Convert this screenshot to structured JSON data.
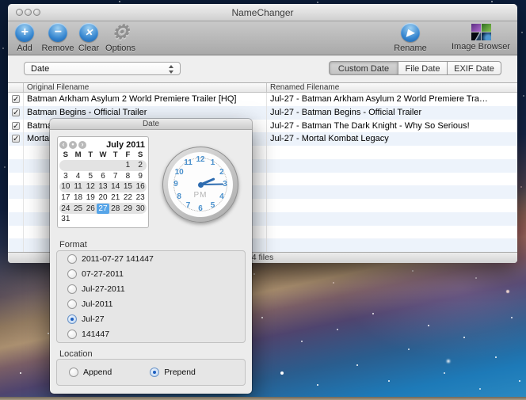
{
  "icons": {
    "add": "+",
    "remove": "−",
    "clear": "✕",
    "options_gear": "⚙",
    "rename_play": "▶",
    "check": "✓",
    "cal_prev": "‹",
    "cal_today": "•",
    "cal_next": "›"
  },
  "colors": {
    "accent_blue": "#2e7bc4",
    "selected_day_blue": "#57a5e8",
    "alt_row_blue": "#edf3fb"
  },
  "window": {
    "title": "NameChanger",
    "toolbar": {
      "add": "Add",
      "remove": "Remove",
      "clear": "Clear",
      "options": "Options",
      "rename": "Rename",
      "image_browser": "Image Browser"
    },
    "filter": {
      "action_value": "Date",
      "segments": [
        "Custom Date",
        "File Date",
        "EXIF Date"
      ],
      "selected_segment": "Custom Date"
    },
    "table": {
      "columns": [
        "Original Filename",
        "Renamed Filename"
      ],
      "rows": [
        {
          "checked": true,
          "original": "Batman Arkham Asylum 2 World Premiere Trailer [HQ]",
          "renamed": "Jul-27 - Batman Arkham Asylum 2 World Premiere Tra…"
        },
        {
          "checked": true,
          "original": "Batman Begins - Official Trailer",
          "renamed": "Jul-27 - Batman Begins - Official Trailer"
        },
        {
          "checked": true,
          "original": "Batman The Dark Knight - Why So Serious!",
          "renamed": "Jul-27 - Batman The Dark Knight - Why So Serious!"
        },
        {
          "checked": true,
          "original": "Mortal Kombat Legacy",
          "renamed": "Jul-27 - Mortal Kombat Legacy"
        }
      ]
    },
    "status": "4 files"
  },
  "date_panel": {
    "title": "Date",
    "calendar": {
      "month_label": "July 2011",
      "day_headers": [
        "S",
        "M",
        "T",
        "W",
        "T",
        "F",
        "S"
      ],
      "weeks": [
        [
          "",
          "",
          "",
          "",
          "",
          "1",
          "2"
        ],
        [
          "3",
          "4",
          "5",
          "6",
          "7",
          "8",
          "9"
        ],
        [
          "10",
          "11",
          "12",
          "13",
          "14",
          "15",
          "16"
        ],
        [
          "17",
          "18",
          "19",
          "20",
          "21",
          "22",
          "23"
        ],
        [
          "24",
          "25",
          "26",
          "27",
          "28",
          "29",
          "30"
        ],
        [
          "31",
          "",
          "",
          "",
          "",
          "",
          ""
        ]
      ],
      "selected_day": "27"
    },
    "clock": {
      "numerals": [
        "1",
        "2",
        "3",
        "4",
        "5",
        "6",
        "7",
        "8",
        "9",
        "10",
        "11",
        "12"
      ],
      "period": "PM",
      "hour_angle_deg": 67,
      "minute_angle_deg": 89
    },
    "format": {
      "label": "Format",
      "options": [
        "2011-07-27 141447",
        "07-27-2011",
        "Jul-27-2011",
        "Jul-2011",
        "Jul-27",
        "141447"
      ],
      "selected": "Jul-27"
    },
    "location": {
      "label": "Location",
      "options": [
        "Append",
        "Prepend"
      ],
      "selected": "Prepend"
    }
  }
}
